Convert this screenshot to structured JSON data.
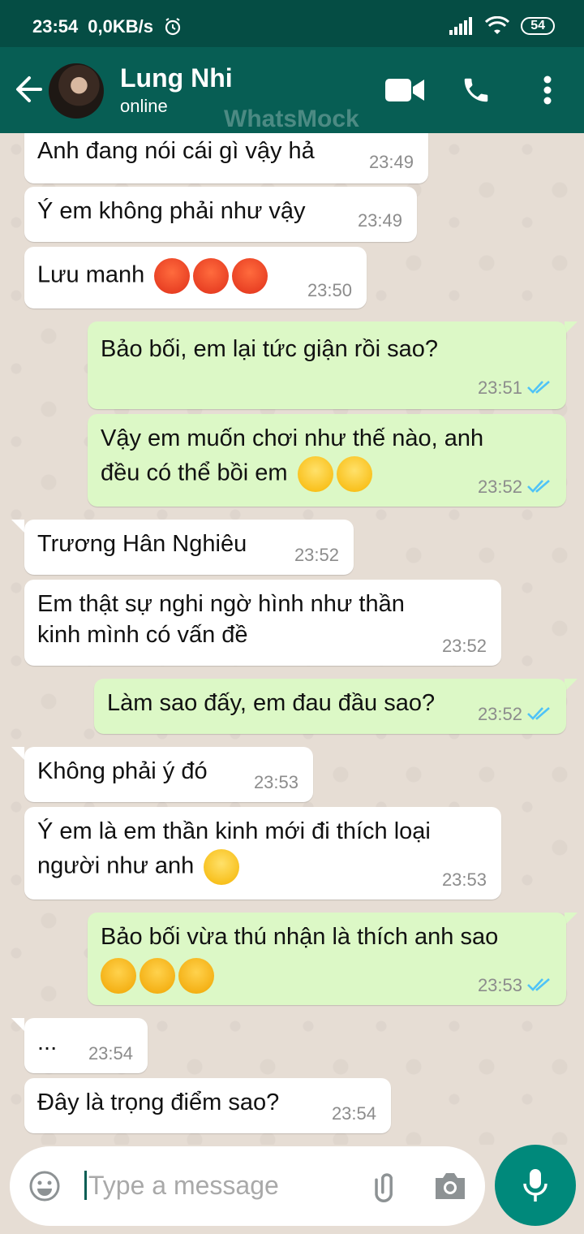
{
  "status_bar": {
    "time": "23:54",
    "speed": "0,0KB/s",
    "battery": "54"
  },
  "header": {
    "name": "Lung Nhi",
    "status": "online",
    "watermark": "WhatsMock"
  },
  "messages": [
    {
      "text": "Anh đang nói cái gì vậy hả",
      "time": "23:49"
    },
    {
      "text": "Ý em không phải như vậy",
      "time": "23:49"
    },
    {
      "text": "Lưu manh",
      "time": "23:50",
      "emoji": "angry-face-emoji x3"
    },
    {
      "text": "Bảo bối, em lại tức giận rồi sao?",
      "time": "23:51"
    },
    {
      "line1": "Vậy em muốn chơi như thế nào, anh",
      "line2": "đều có thể bồi em",
      "time": "23:52",
      "emoji": "relieved-face-emoji x2"
    },
    {
      "text": "Trương Hân Nghiêu",
      "time": "23:52"
    },
    {
      "line1": "Em thật sự nghi ngờ hình như thần",
      "line2": "kinh mình có vấn đề",
      "time": "23:52"
    },
    {
      "text": "Làm sao đấy, em đau đầu sao?",
      "time": "23:52"
    },
    {
      "text": "Không phải ý đó",
      "time": "23:53"
    },
    {
      "line1": "Ý em là em thần kinh mới đi thích loại",
      "line2": "người như anh",
      "time": "23:53",
      "emoji": "slightly-smiling-face-emoji"
    },
    {
      "text": "Bảo bối vừa thú nhận là thích anh sao",
      "time": "23:53",
      "emoji": "flushed-face-emoji x3"
    },
    {
      "text": "...",
      "time": "23:54"
    },
    {
      "text": "Đây là trọng điểm sao?",
      "time": "23:54"
    }
  ],
  "input": {
    "placeholder": "Type a message"
  },
  "colors": {
    "header": "#075e54",
    "status_bar": "#054d44",
    "outgoing_bubble": "#dcf8c6",
    "incoming_bubble": "#ffffff",
    "read_ticks": "#4fc3f7",
    "mic_button": "#00897b"
  }
}
